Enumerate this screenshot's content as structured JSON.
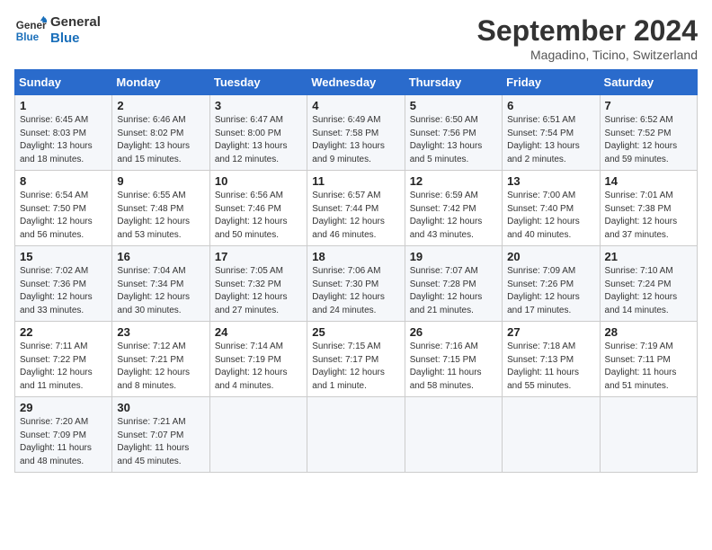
{
  "header": {
    "logo_line1": "General",
    "logo_line2": "Blue",
    "month": "September 2024",
    "location": "Magadino, Ticino, Switzerland"
  },
  "weekdays": [
    "Sunday",
    "Monday",
    "Tuesday",
    "Wednesday",
    "Thursday",
    "Friday",
    "Saturday"
  ],
  "weeks": [
    [
      {
        "day": "1",
        "info": "Sunrise: 6:45 AM\nSunset: 8:03 PM\nDaylight: 13 hours\nand 18 minutes."
      },
      {
        "day": "2",
        "info": "Sunrise: 6:46 AM\nSunset: 8:02 PM\nDaylight: 13 hours\nand 15 minutes."
      },
      {
        "day": "3",
        "info": "Sunrise: 6:47 AM\nSunset: 8:00 PM\nDaylight: 13 hours\nand 12 minutes."
      },
      {
        "day": "4",
        "info": "Sunrise: 6:49 AM\nSunset: 7:58 PM\nDaylight: 13 hours\nand 9 minutes."
      },
      {
        "day": "5",
        "info": "Sunrise: 6:50 AM\nSunset: 7:56 PM\nDaylight: 13 hours\nand 5 minutes."
      },
      {
        "day": "6",
        "info": "Sunrise: 6:51 AM\nSunset: 7:54 PM\nDaylight: 13 hours\nand 2 minutes."
      },
      {
        "day": "7",
        "info": "Sunrise: 6:52 AM\nSunset: 7:52 PM\nDaylight: 12 hours\nand 59 minutes."
      }
    ],
    [
      {
        "day": "8",
        "info": "Sunrise: 6:54 AM\nSunset: 7:50 PM\nDaylight: 12 hours\nand 56 minutes."
      },
      {
        "day": "9",
        "info": "Sunrise: 6:55 AM\nSunset: 7:48 PM\nDaylight: 12 hours\nand 53 minutes."
      },
      {
        "day": "10",
        "info": "Sunrise: 6:56 AM\nSunset: 7:46 PM\nDaylight: 12 hours\nand 50 minutes."
      },
      {
        "day": "11",
        "info": "Sunrise: 6:57 AM\nSunset: 7:44 PM\nDaylight: 12 hours\nand 46 minutes."
      },
      {
        "day": "12",
        "info": "Sunrise: 6:59 AM\nSunset: 7:42 PM\nDaylight: 12 hours\nand 43 minutes."
      },
      {
        "day": "13",
        "info": "Sunrise: 7:00 AM\nSunset: 7:40 PM\nDaylight: 12 hours\nand 40 minutes."
      },
      {
        "day": "14",
        "info": "Sunrise: 7:01 AM\nSunset: 7:38 PM\nDaylight: 12 hours\nand 37 minutes."
      }
    ],
    [
      {
        "day": "15",
        "info": "Sunrise: 7:02 AM\nSunset: 7:36 PM\nDaylight: 12 hours\nand 33 minutes."
      },
      {
        "day": "16",
        "info": "Sunrise: 7:04 AM\nSunset: 7:34 PM\nDaylight: 12 hours\nand 30 minutes."
      },
      {
        "day": "17",
        "info": "Sunrise: 7:05 AM\nSunset: 7:32 PM\nDaylight: 12 hours\nand 27 minutes."
      },
      {
        "day": "18",
        "info": "Sunrise: 7:06 AM\nSunset: 7:30 PM\nDaylight: 12 hours\nand 24 minutes."
      },
      {
        "day": "19",
        "info": "Sunrise: 7:07 AM\nSunset: 7:28 PM\nDaylight: 12 hours\nand 21 minutes."
      },
      {
        "day": "20",
        "info": "Sunrise: 7:09 AM\nSunset: 7:26 PM\nDaylight: 12 hours\nand 17 minutes."
      },
      {
        "day": "21",
        "info": "Sunrise: 7:10 AM\nSunset: 7:24 PM\nDaylight: 12 hours\nand 14 minutes."
      }
    ],
    [
      {
        "day": "22",
        "info": "Sunrise: 7:11 AM\nSunset: 7:22 PM\nDaylight: 12 hours\nand 11 minutes."
      },
      {
        "day": "23",
        "info": "Sunrise: 7:12 AM\nSunset: 7:21 PM\nDaylight: 12 hours\nand 8 minutes."
      },
      {
        "day": "24",
        "info": "Sunrise: 7:14 AM\nSunset: 7:19 PM\nDaylight: 12 hours\nand 4 minutes."
      },
      {
        "day": "25",
        "info": "Sunrise: 7:15 AM\nSunset: 7:17 PM\nDaylight: 12 hours\nand 1 minute."
      },
      {
        "day": "26",
        "info": "Sunrise: 7:16 AM\nSunset: 7:15 PM\nDaylight: 11 hours\nand 58 minutes."
      },
      {
        "day": "27",
        "info": "Sunrise: 7:18 AM\nSunset: 7:13 PM\nDaylight: 11 hours\nand 55 minutes."
      },
      {
        "day": "28",
        "info": "Sunrise: 7:19 AM\nSunset: 7:11 PM\nDaylight: 11 hours\nand 51 minutes."
      }
    ],
    [
      {
        "day": "29",
        "info": "Sunrise: 7:20 AM\nSunset: 7:09 PM\nDaylight: 11 hours\nand 48 minutes."
      },
      {
        "day": "30",
        "info": "Sunrise: 7:21 AM\nSunset: 7:07 PM\nDaylight: 11 hours\nand 45 minutes."
      },
      {
        "day": "",
        "info": ""
      },
      {
        "day": "",
        "info": ""
      },
      {
        "day": "",
        "info": ""
      },
      {
        "day": "",
        "info": ""
      },
      {
        "day": "",
        "info": ""
      }
    ]
  ]
}
